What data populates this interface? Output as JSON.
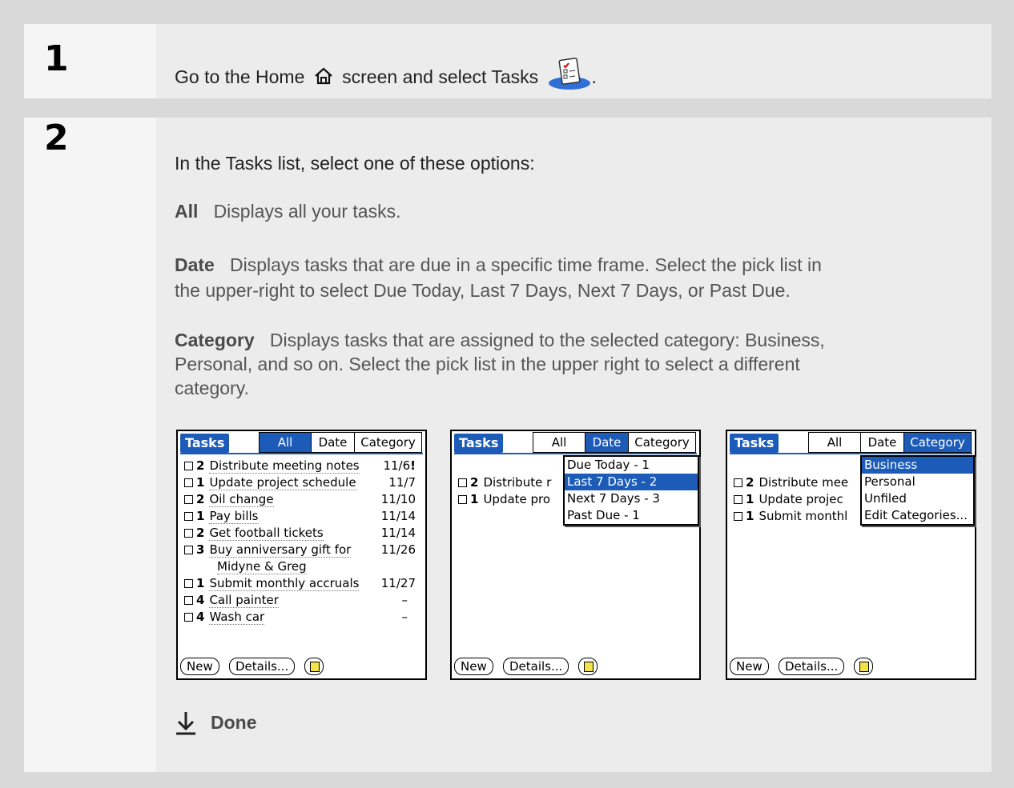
{
  "steps": [
    {
      "number": "1",
      "text_before": "Go to the Home",
      "text_middle": "screen and select Tasks",
      "text_after": "."
    },
    {
      "number": "2",
      "intro": "In the Tasks list, select one of these options:"
    }
  ],
  "options": [
    {
      "label": "All",
      "desc": "Displays all your tasks."
    },
    {
      "label": "Date",
      "desc": "Displays tasks that are due in a specific time frame. Select the pick list in",
      "desc2": "the upper-right to select Due Today, Last 7 Days, Next 7 Days, or Past Due."
    },
    {
      "label": "Category",
      "desc": "Displays tasks that are assigned to the selected category: Business,",
      "desc2": "Personal, and so on. Select the pick list in the upper right to select a different",
      "desc3": "category."
    }
  ],
  "screens": [
    {
      "title": "Tasks",
      "tabs": [
        "All",
        "Date",
        "Category"
      ],
      "selected_tab": "All",
      "rows": [
        {
          "pri": "2",
          "text": "Distribute meeting notes",
          "due": "11/6",
          "flag": "!"
        },
        {
          "pri": "1",
          "text": "Update project schedule",
          "due": "11/7"
        },
        {
          "pri": "2",
          "text": "Oil change",
          "due": "11/10"
        },
        {
          "pri": "1",
          "text": "Pay bills",
          "due": "11/14"
        },
        {
          "pri": "2",
          "text": "Get football tickets",
          "due": "11/14"
        },
        {
          "pri": "3",
          "text": "Buy anniversary gift for",
          "due": "11/26",
          "cont": "Midyne & Greg"
        },
        {
          "pri": "1",
          "text": "Submit monthly accruals",
          "due": "11/27"
        },
        {
          "pri": "4",
          "text": "Call painter",
          "due": "–"
        },
        {
          "pri": "4",
          "text": "Wash car",
          "due": "–"
        }
      ],
      "buttons": [
        "New",
        "Details..."
      ]
    },
    {
      "title": "Tasks",
      "tabs": [
        "All",
        "Date",
        "Category"
      ],
      "selected_tab": "Date",
      "rows": [
        {
          "pri": "2",
          "text": "Distribute r"
        },
        {
          "pri": "1",
          "text": "Update pro"
        }
      ],
      "popup": [
        "Due Today - 1",
        "Last 7 Days - 2",
        "Next 7 Days - 3",
        "Past Due - 1"
      ],
      "popup_selected": "Last 7 Days - 2",
      "buttons": [
        "New",
        "Details..."
      ]
    },
    {
      "title": "Tasks",
      "tabs": [
        "All",
        "Date",
        "Category"
      ],
      "selected_tab": "Category",
      "rows": [
        {
          "pri": "2",
          "text": "Distribute mee"
        },
        {
          "pri": "1",
          "text": "Update projec"
        },
        {
          "pri": "1",
          "text": "Submit monthl"
        }
      ],
      "popup": [
        "Business",
        "Personal",
        "Unfiled",
        "Edit Categories..."
      ],
      "popup_selected": "Business",
      "buttons": [
        "New",
        "Details..."
      ]
    }
  ],
  "done_label": "Done",
  "colors": {
    "title_bar": "#1c5cb8",
    "note_yellow": "#f3e34a"
  },
  "icons": [
    "home-icon",
    "tasks-app-icon",
    "down-arrow-icon",
    "note-icon"
  ]
}
